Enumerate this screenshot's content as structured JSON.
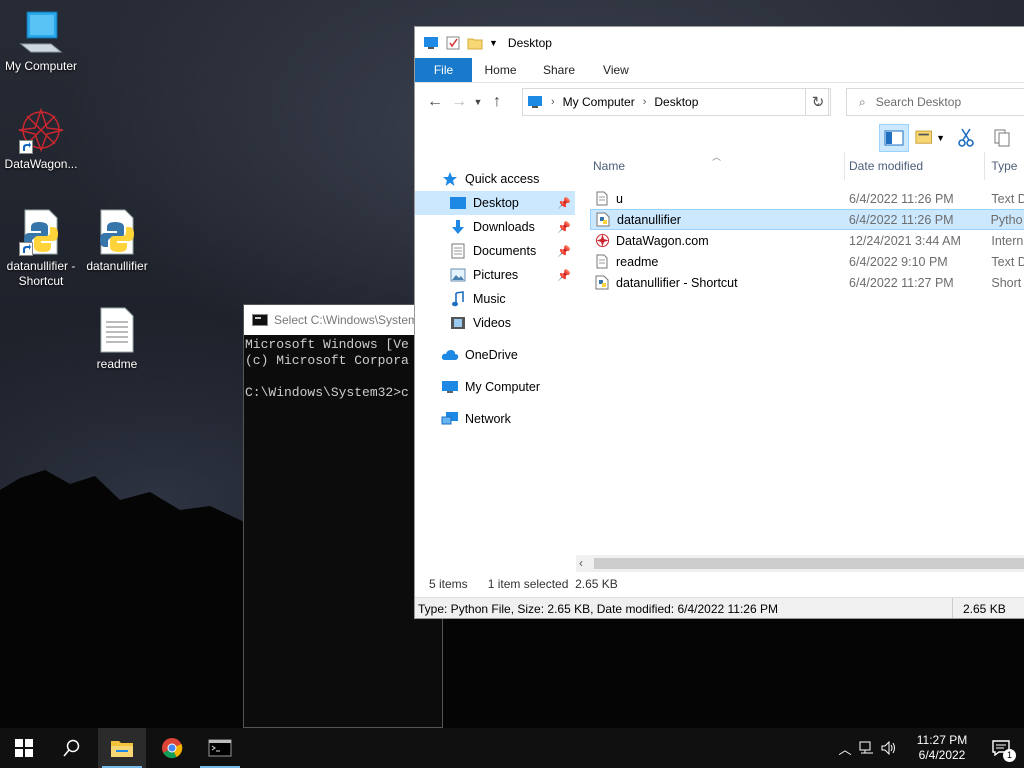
{
  "desktop": {
    "icons": [
      {
        "label": "My Computer",
        "icon": "computer-icon"
      },
      {
        "label": "DataWagon...",
        "icon": "datawagon-logo-icon"
      },
      {
        "label": "datanullifier - Shortcut",
        "icon": "python-file-icon"
      },
      {
        "label": "datanullifier",
        "icon": "python-file-icon"
      },
      {
        "label": "readme",
        "icon": "text-file-icon"
      }
    ]
  },
  "cmd": {
    "title": "Select C:\\Windows\\System",
    "lines": [
      "Microsoft Windows [Ve",
      "(c) Microsoft Corpora",
      "",
      "C:\\Windows\\System32>c"
    ]
  },
  "explorer": {
    "title": "Desktop",
    "ribbon_tabs": [
      "File",
      "Home",
      "Share",
      "View"
    ],
    "address": {
      "segments": [
        "My Computer",
        "Desktop"
      ]
    },
    "search_placeholder": "Search Desktop",
    "nav_pane": [
      {
        "label": "Quick access",
        "icon": "star-icon",
        "level": 1
      },
      {
        "label": "Desktop",
        "icon": "desktop-folder-icon",
        "level": 2,
        "pinned": true,
        "selected": true
      },
      {
        "label": "Downloads",
        "icon": "downloads-icon",
        "level": 2,
        "pinned": true
      },
      {
        "label": "Documents",
        "icon": "documents-icon",
        "level": 2,
        "pinned": true
      },
      {
        "label": "Pictures",
        "icon": "pictures-icon",
        "level": 2,
        "pinned": true
      },
      {
        "label": "Music",
        "icon": "music-icon",
        "level": 2
      },
      {
        "label": "Videos",
        "icon": "videos-icon",
        "level": 2
      },
      {
        "label": "OneDrive",
        "icon": "onedrive-icon",
        "level": 1
      },
      {
        "label": "My Computer",
        "icon": "computer-icon",
        "level": 1
      },
      {
        "label": "Network",
        "icon": "network-icon",
        "level": 1
      }
    ],
    "columns": {
      "name": "Name",
      "date": "Date modified",
      "type": "Type"
    },
    "files": [
      {
        "name": "u",
        "date": "6/4/2022 11:26 PM",
        "type": "Text D",
        "icon": "text-file-icon"
      },
      {
        "name": "datanullifier",
        "date": "6/4/2022 11:26 PM",
        "type": "Pytho",
        "icon": "python-file-icon",
        "selected": true
      },
      {
        "name": "DataWagon.com",
        "date": "12/24/2021 3:44 AM",
        "type": "Intern",
        "icon": "internet-shortcut-icon"
      },
      {
        "name": "readme",
        "date": "6/4/2022 9:10 PM",
        "type": "Text D",
        "icon": "text-file-icon"
      },
      {
        "name": "datanullifier - Shortcut",
        "date": "6/4/2022 11:27 PM",
        "type": "Short",
        "icon": "python-file-icon"
      }
    ],
    "status": {
      "items": "5 items",
      "selected": "1 item selected  2.65 KB"
    },
    "details": {
      "left": "Type: Python File, Size: 2.65 KB, Date modified: 6/4/2022 11:26 PM",
      "right": "2.65 KB"
    }
  },
  "taskbar": {
    "clock_time": "11:27 PM",
    "clock_date": "6/4/2022",
    "notification_count": "1",
    "accent": "#76b9ed"
  }
}
